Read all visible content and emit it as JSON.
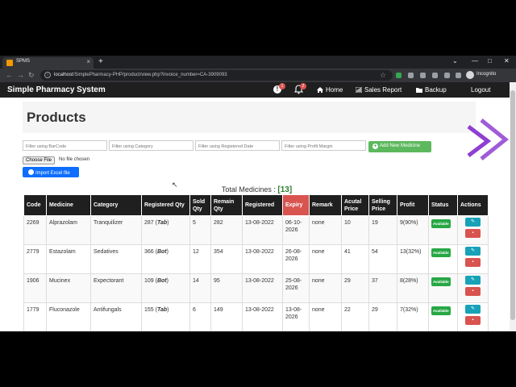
{
  "browser": {
    "tab_title": "SPMS",
    "url_host": "localhost",
    "url_path": "/SimplePharmacy-PHP/product/view.php?invoice_number=CA-3909093",
    "profile_label": "Incognito"
  },
  "app": {
    "brand": "Simple Pharmacy System",
    "alerts": [
      {
        "name": "expiry-alert",
        "count": "1"
      },
      {
        "name": "notification-bell",
        "count": "2"
      }
    ],
    "nav": {
      "home": "Home",
      "sales_report": "Sales Report",
      "backup": "Backup",
      "logout": "Logout"
    }
  },
  "page": {
    "title": "Products",
    "filters": {
      "barcode_placeholder": "Filter using BarCode",
      "category_placeholder": "Filter using Category",
      "date_placeholder": "Filter using Registered Date",
      "margin_placeholder": "Filter using Profit Margin"
    },
    "add_button": "Add New Medicine",
    "choose_file": "Choose File",
    "no_file": "No file chosen",
    "import_button": "Import Excel file",
    "total_label": "Total Medicines :",
    "total_count": "[13]"
  },
  "table": {
    "headers": [
      "Code",
      "Medicine",
      "Category",
      "Registered Qty",
      "Sold Qty",
      "Remain Qty",
      "Registered",
      "Expiry",
      "Remark",
      "Acutal Price",
      "Selling Price",
      "Profit",
      "Status",
      "Actions"
    ],
    "rows": [
      {
        "code": "2269",
        "medicine": "Alprazolam",
        "category": "Tranquilizer",
        "reg_qty": "287",
        "unit": "Tab",
        "sold": "5",
        "remain": "282",
        "registered": "13-08-2022",
        "expiry": "06-10-2026",
        "remark": "none",
        "actual": "10",
        "selling": "19",
        "profit": "9(90%)",
        "status": "Available"
      },
      {
        "code": "2779",
        "medicine": "Estazolam",
        "category": "Sedatives",
        "reg_qty": "366",
        "unit": "Bot",
        "sold": "12",
        "remain": "354",
        "registered": "13-08-2022",
        "expiry": "26-08-2026",
        "remark": "none",
        "actual": "41",
        "selling": "54",
        "profit": "13(32%)",
        "status": "Available"
      },
      {
        "code": "1906",
        "medicine": "Mucinex",
        "category": "Expectorant",
        "reg_qty": "109",
        "unit": "Bot",
        "sold": "14",
        "remain": "95",
        "registered": "13-08-2022",
        "expiry": "25-08-2026",
        "remark": "none",
        "actual": "29",
        "selling": "37",
        "profit": "8(28%)",
        "status": "Available"
      },
      {
        "code": "1779",
        "medicine": "Fluconazole",
        "category": "Antifungals",
        "reg_qty": "155",
        "unit": "Tab",
        "sold": "6",
        "remain": "149",
        "registered": "13-08-2022",
        "expiry": "13-08-2026",
        "remark": "none",
        "actual": "22",
        "selling": "29",
        "profit": "7(32%)",
        "status": "Available"
      }
    ]
  },
  "colors": {
    "navbar": "#1f1f1f",
    "expiry_header": "#d9534f",
    "add_button": "#5cb85c",
    "import_button": "#0d6efd",
    "status_available": "#28a745",
    "edit_action": "#17a2b8",
    "delete_action": "#d9534f"
  },
  "icons": {
    "edit": "pencil-icon",
    "delete": "trash-icon"
  }
}
